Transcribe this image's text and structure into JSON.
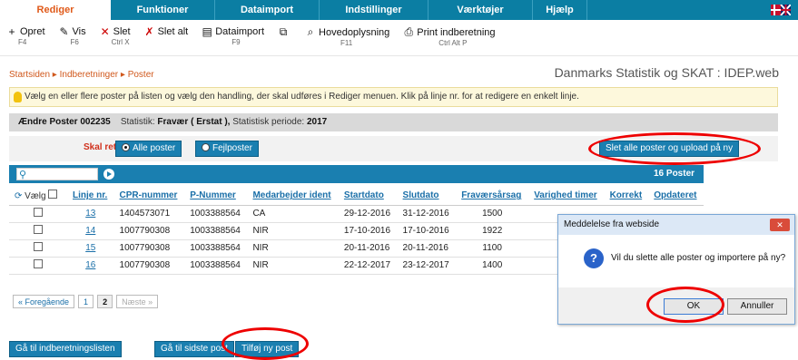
{
  "tabs": [
    "Rediger",
    "Funktioner",
    "Dataimport",
    "Indstillinger",
    "Værktøjer",
    "Hjælp"
  ],
  "toolbar": [
    {
      "label": "Opret",
      "key": "F4",
      "icon": "plus-icon"
    },
    {
      "label": "Vis",
      "key": "F6",
      "icon": "pencil-icon"
    },
    {
      "label": "Slet",
      "key": "Ctrl X",
      "icon": "x-icon"
    },
    {
      "label": "Slet alt",
      "key": "",
      "icon": "x-all-icon"
    },
    {
      "label": "Dataimport",
      "key": "F9",
      "icon": "import-icon"
    },
    {
      "label": "",
      "key": "",
      "icon": "copy-icon"
    },
    {
      "label": "Hovedoplysning",
      "key": "F11",
      "icon": "search-doc-icon"
    },
    {
      "label": "Print indberetning",
      "key": "Ctrl Alt P",
      "icon": "printer-icon"
    }
  ],
  "breadcrumb": {
    "a": "Startsiden",
    "b": "Indberetninger",
    "c": "Poster"
  },
  "brand": "Danmarks Statistik og SKAT : IDEP.web",
  "info": "Vælg en eller flere poster på listen og vælg den handling, der skal udføres i Rediger menuen. Klik på linje nr. for at redigere en enkelt linje.",
  "edit": {
    "title": "Ændre Poster 002235",
    "stat_label": "Statistik:",
    "stat_value": "Fravær ( Erstat ),",
    "period_label": "Statistisk periode:",
    "period_value": "2017"
  },
  "filter": {
    "label": "Skal rettes",
    "all": "Alle poster",
    "err": "Fejlposter",
    "delete_btn": "Slet alle poster og upload på ny"
  },
  "grid": {
    "count": "16 Poster",
    "select_label": "Vælg",
    "columns": [
      "Linje nr.",
      "CPR-nummer",
      "P-Nummer",
      "Medarbejder ident",
      "Startdato",
      "Slutdato",
      "Fraværsårsag",
      "Varighed timer",
      "Korrekt",
      "Opdateret"
    ],
    "rows": [
      [
        "13",
        "1404573071",
        "1003388564",
        "CA",
        "29-12-2016",
        "31-12-2016",
        "1500"
      ],
      [
        "14",
        "1007790308",
        "1003388564",
        "NIR",
        "17-10-2016",
        "17-10-2016",
        "1922"
      ],
      [
        "15",
        "1007790308",
        "1003388564",
        "NIR",
        "20-11-2016",
        "20-11-2016",
        "1100"
      ],
      [
        "16",
        "1007790308",
        "1003388564",
        "NIR",
        "22-12-2017",
        "23-12-2017",
        "1400"
      ]
    ]
  },
  "pager": {
    "prev": "« Foregående",
    "p1": "1",
    "p2": "2",
    "next": "Næste »"
  },
  "dialog": {
    "title": "Meddelelse fra webside",
    "close": "✕",
    "message": "Vil du slette alle poster og importere på ny?",
    "ok": "OK",
    "cancel": "Annuller"
  },
  "bottom": {
    "back": "Gå til indberetningslisten",
    "last": "Gå til sidste post",
    "add": "Tilføj ny post"
  }
}
